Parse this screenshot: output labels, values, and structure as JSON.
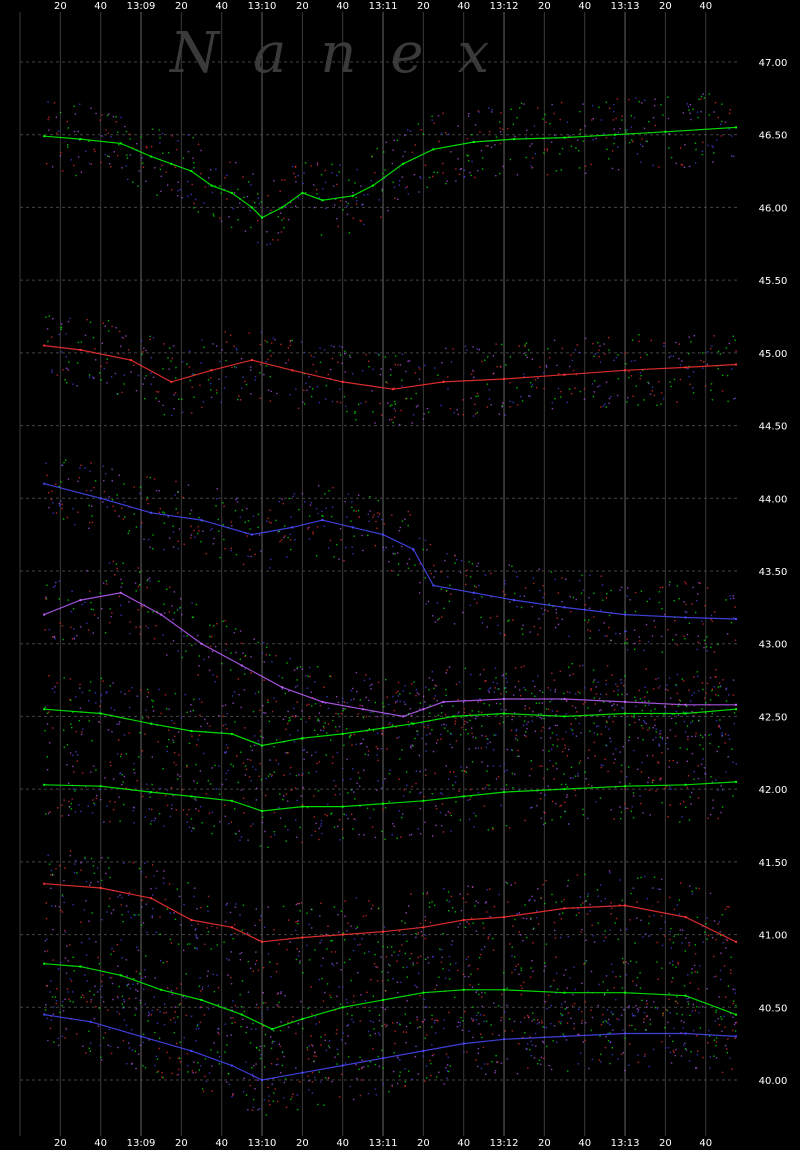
{
  "watermark": "Nanex",
  "chart_data": {
    "type": "scatter",
    "title": "",
    "xlabel": "",
    "ylabel": "",
    "x_tick_labels": [
      "20",
      "40",
      "13:09",
      "20",
      "40",
      "13:10",
      "20",
      "40",
      "13:11",
      "20",
      "40",
      "13:12",
      "20",
      "40",
      "13:13",
      "20",
      "40"
    ],
    "x_tick_seconds": [
      20,
      40,
      60,
      80,
      100,
      120,
      140,
      160,
      180,
      200,
      220,
      240,
      260,
      280,
      300,
      320,
      340
    ],
    "xlim_seconds": [
      0,
      357
    ],
    "y_tick_labels": [
      "47.00",
      "46.50",
      "46.00",
      "45.50",
      "45.00",
      "44.50",
      "44.00",
      "43.50",
      "43.00",
      "42.50",
      "42.00",
      "41.50",
      "41.00",
      "40.50",
      "40.00"
    ],
    "ylim": [
      39.87,
      47.3
    ],
    "grid": true,
    "x_axis": "top-and-bottom",
    "y_axis": "right",
    "colors": {
      "background": "#000000",
      "grid_time": "#555555",
      "grid_price": "#444444",
      "tick_text": "#ffffff",
      "watermark": "#3a3a3a",
      "series": [
        "#00ff00",
        "#ff3333",
        "#4a4aff",
        "#c060ff"
      ]
    },
    "series": [
      {
        "color": "#00ff00",
        "points": [
          [
            12,
            46.49
          ],
          [
            30,
            46.47
          ],
          [
            50,
            46.44
          ],
          [
            65,
            46.35
          ],
          [
            75,
            46.3
          ],
          [
            85,
            46.25
          ],
          [
            95,
            46.15
          ],
          [
            105,
            46.1
          ],
          [
            115,
            46.0
          ],
          [
            120,
            45.93
          ],
          [
            130,
            46.0
          ],
          [
            140,
            46.1
          ],
          [
            150,
            46.05
          ],
          [
            165,
            46.08
          ],
          [
            175,
            46.15
          ],
          [
            190,
            46.3
          ],
          [
            205,
            46.4
          ],
          [
            225,
            46.45
          ],
          [
            245,
            46.47
          ],
          [
            270,
            46.48
          ],
          [
            295,
            46.5
          ],
          [
            320,
            46.52
          ],
          [
            355,
            46.55
          ]
        ]
      },
      {
        "color": "#ff3333",
        "points": [
          [
            12,
            45.05
          ],
          [
            30,
            45.02
          ],
          [
            55,
            44.95
          ],
          [
            75,
            44.8
          ],
          [
            95,
            44.88
          ],
          [
            115,
            44.95
          ],
          [
            135,
            44.88
          ],
          [
            160,
            44.8
          ],
          [
            185,
            44.75
          ],
          [
            210,
            44.8
          ],
          [
            240,
            44.82
          ],
          [
            270,
            44.85
          ],
          [
            300,
            44.88
          ],
          [
            330,
            44.9
          ],
          [
            355,
            44.92
          ]
        ]
      },
      {
        "color": "#4a4aff",
        "points": [
          [
            12,
            44.1
          ],
          [
            40,
            44.0
          ],
          [
            65,
            43.9
          ],
          [
            90,
            43.85
          ],
          [
            115,
            43.75
          ],
          [
            135,
            43.8
          ],
          [
            150,
            43.85
          ],
          [
            165,
            43.8
          ],
          [
            180,
            43.75
          ],
          [
            195,
            43.65
          ],
          [
            205,
            43.4
          ],
          [
            225,
            43.35
          ],
          [
            245,
            43.3
          ],
          [
            270,
            43.25
          ],
          [
            300,
            43.2
          ],
          [
            330,
            43.18
          ],
          [
            355,
            43.17
          ]
        ]
      },
      {
        "color": "#c060ff",
        "points": [
          [
            12,
            43.2
          ],
          [
            30,
            43.3
          ],
          [
            50,
            43.35
          ],
          [
            70,
            43.2
          ],
          [
            90,
            43.0
          ],
          [
            110,
            42.85
          ],
          [
            130,
            42.7
          ],
          [
            150,
            42.6
          ],
          [
            170,
            42.55
          ],
          [
            190,
            42.5
          ],
          [
            200,
            42.55
          ],
          [
            210,
            42.6
          ],
          [
            240,
            42.62
          ],
          [
            270,
            42.62
          ],
          [
            300,
            42.6
          ],
          [
            330,
            42.58
          ],
          [
            355,
            42.58
          ]
        ]
      },
      {
        "color": "#00ff00",
        "points": [
          [
            12,
            42.55
          ],
          [
            40,
            42.52
          ],
          [
            65,
            42.45
          ],
          [
            85,
            42.4
          ],
          [
            105,
            42.38
          ],
          [
            120,
            42.3
          ],
          [
            140,
            42.35
          ],
          [
            160,
            42.38
          ],
          [
            180,
            42.42
          ],
          [
            195,
            42.45
          ],
          [
            215,
            42.5
          ],
          [
            240,
            42.52
          ],
          [
            270,
            42.5
          ],
          [
            300,
            42.52
          ],
          [
            330,
            42.52
          ],
          [
            355,
            42.55
          ]
        ]
      },
      {
        "color": "#00ff00",
        "points": [
          [
            12,
            42.03
          ],
          [
            40,
            42.02
          ],
          [
            65,
            41.98
          ],
          [
            85,
            41.95
          ],
          [
            105,
            41.92
          ],
          [
            120,
            41.85
          ],
          [
            140,
            41.88
          ],
          [
            160,
            41.88
          ],
          [
            180,
            41.9
          ],
          [
            200,
            41.92
          ],
          [
            220,
            41.95
          ],
          [
            240,
            41.98
          ],
          [
            270,
            42.0
          ],
          [
            300,
            42.02
          ],
          [
            330,
            42.03
          ],
          [
            355,
            42.05
          ]
        ]
      },
      {
        "color": "#ff3333",
        "points": [
          [
            12,
            41.35
          ],
          [
            40,
            41.32
          ],
          [
            65,
            41.25
          ],
          [
            85,
            41.1
          ],
          [
            105,
            41.05
          ],
          [
            120,
            40.95
          ],
          [
            140,
            40.98
          ],
          [
            160,
            41.0
          ],
          [
            180,
            41.02
          ],
          [
            200,
            41.05
          ],
          [
            220,
            41.1
          ],
          [
            240,
            41.12
          ],
          [
            270,
            41.18
          ],
          [
            300,
            41.2
          ],
          [
            330,
            41.12
          ],
          [
            355,
            40.95
          ]
        ]
      },
      {
        "color": "#00ff00",
        "points": [
          [
            12,
            40.8
          ],
          [
            30,
            40.78
          ],
          [
            50,
            40.72
          ],
          [
            70,
            40.62
          ],
          [
            90,
            40.55
          ],
          [
            110,
            40.45
          ],
          [
            125,
            40.35
          ],
          [
            140,
            40.42
          ],
          [
            160,
            40.5
          ],
          [
            180,
            40.55
          ],
          [
            200,
            40.6
          ],
          [
            220,
            40.62
          ],
          [
            240,
            40.62
          ],
          [
            270,
            40.6
          ],
          [
            300,
            40.6
          ],
          [
            330,
            40.58
          ],
          [
            355,
            40.45
          ]
        ]
      },
      {
        "color": "#4a4aff",
        "points": [
          [
            12,
            40.45
          ],
          [
            35,
            40.4
          ],
          [
            60,
            40.3
          ],
          [
            85,
            40.2
          ],
          [
            105,
            40.1
          ],
          [
            120,
            40.0
          ],
          [
            140,
            40.05
          ],
          [
            160,
            40.1
          ],
          [
            180,
            40.15
          ],
          [
            200,
            40.2
          ],
          [
            220,
            40.25
          ],
          [
            240,
            40.28
          ],
          [
            270,
            40.3
          ],
          [
            300,
            40.32
          ],
          [
            330,
            40.32
          ],
          [
            355,
            40.3
          ]
        ]
      }
    ]
  }
}
